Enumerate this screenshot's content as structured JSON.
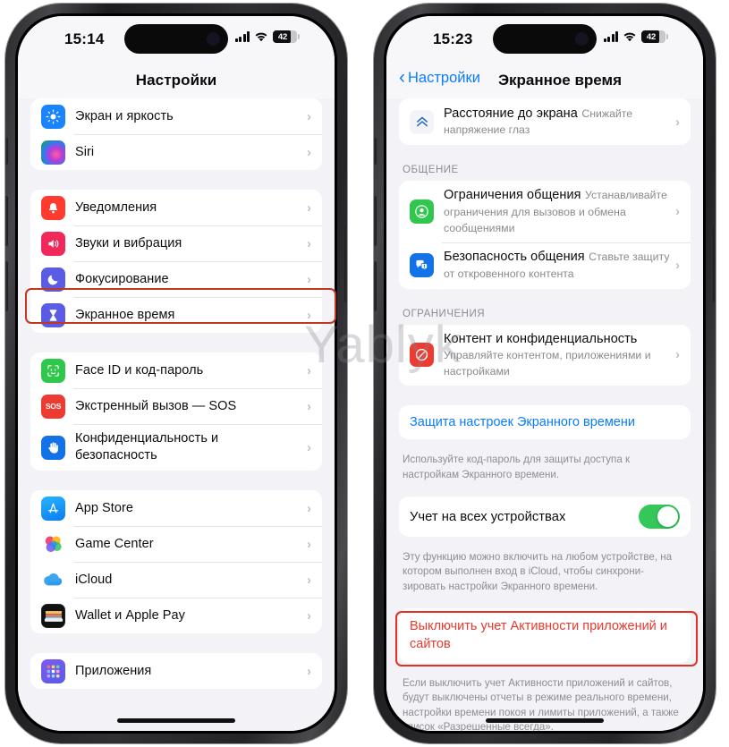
{
  "watermark": "Yablyk",
  "left_phone": {
    "status_bar": {
      "time": "15:14",
      "battery_percent": "42",
      "signal_icon": "cellular-bars-icon",
      "wifi_icon": "wifi-icon",
      "battery_icon": "battery-icon"
    },
    "nav": {
      "title": "Настройки"
    },
    "groups": [
      {
        "rows": [
          {
            "label": "Экран и яркость",
            "icon": "brightness-icon"
          },
          {
            "label": "Siri",
            "icon": "siri-icon"
          }
        ]
      },
      {
        "rows": [
          {
            "label": "Уведомления",
            "icon": "notifications-icon"
          },
          {
            "label": "Звуки и вибрация",
            "icon": "sound-icon"
          },
          {
            "label": "Фокусирование",
            "icon": "focus-icon"
          },
          {
            "label": "Экранное время",
            "icon": "screen-time-icon",
            "highlighted": true
          }
        ]
      },
      {
        "rows": [
          {
            "label": "Face ID и код-пароль",
            "icon": "faceid-icon"
          },
          {
            "label": "Экстренный вызов — SOS",
            "icon": "sos-icon"
          },
          {
            "label": "Конфиденциальность и безопасность",
            "icon": "privacy-icon"
          }
        ]
      },
      {
        "rows": [
          {
            "label": "App Store",
            "icon": "appstore-icon"
          },
          {
            "label": "Game Center",
            "icon": "gamecenter-icon"
          },
          {
            "label": "iCloud",
            "icon": "icloud-icon"
          },
          {
            "label": "Wallet и Apple Pay",
            "icon": "wallet-icon"
          }
        ]
      },
      {
        "rows": [
          {
            "label": "Приложения",
            "icon": "apps-icon"
          }
        ]
      }
    ]
  },
  "right_phone": {
    "status_bar": {
      "time": "15:23",
      "battery_percent": "42",
      "signal_icon": "cellular-bars-icon",
      "wifi_icon": "wifi-icon",
      "battery_icon": "battery-icon"
    },
    "nav": {
      "back_label": "Настройки",
      "title": "Экранное время",
      "back_icon": "chevron-left-icon"
    },
    "screen_distance": {
      "title": "Расстояние до экрана",
      "subtitle": "Снижайте напряжение глаз",
      "icon": "screen-distance-icon"
    },
    "communication": {
      "header": "ОБЩЕНИЕ",
      "rows": [
        {
          "title": "Ограничения общения",
          "subtitle": "Устанавливайте ограничения для вызовов и обмена сообщениями",
          "icon": "communication-limits-icon"
        },
        {
          "title": "Безопасность общения",
          "subtitle": "Ставьте защиту от откровенного контента",
          "icon": "communication-safety-icon"
        }
      ]
    },
    "restrictions": {
      "header": "ОГРАНИЧЕНИЯ",
      "rows": [
        {
          "title": "Контент и конфиденциальность",
          "subtitle": "Управляйте контентом, приложениями и настройками",
          "icon": "content-privacy-icon"
        }
      ]
    },
    "passcode_link": {
      "label": "Защита настроек Экранного времени",
      "footer": "Используйте код-пароль для защиты доступа к настройкам Экранного времени."
    },
    "share_toggle": {
      "label": "Учет на всех устройствах",
      "state": "on",
      "footer": "Эту функцию можно включить на любом устройстве, на котором выполнен вход в iCloud, чтобы синхрони-зировать настройки Экранного времени."
    },
    "turn_off": {
      "label": "Выключить учет Активности приложений и сайтов",
      "highlighted": true,
      "footer": "Если выключить учет Активности приложений и сайтов, будут выключены отчеты в режиме реального времени, настройки времени покоя и лимиты приложений, а также список «Разрешенные всегда»."
    }
  },
  "colors": {
    "accent_blue": "#0a7cff",
    "danger_red": "#e8392e",
    "highlight_box": "#c0391f",
    "toggle_on": "#34c759",
    "bg_grouped": "#f2f2f7"
  }
}
